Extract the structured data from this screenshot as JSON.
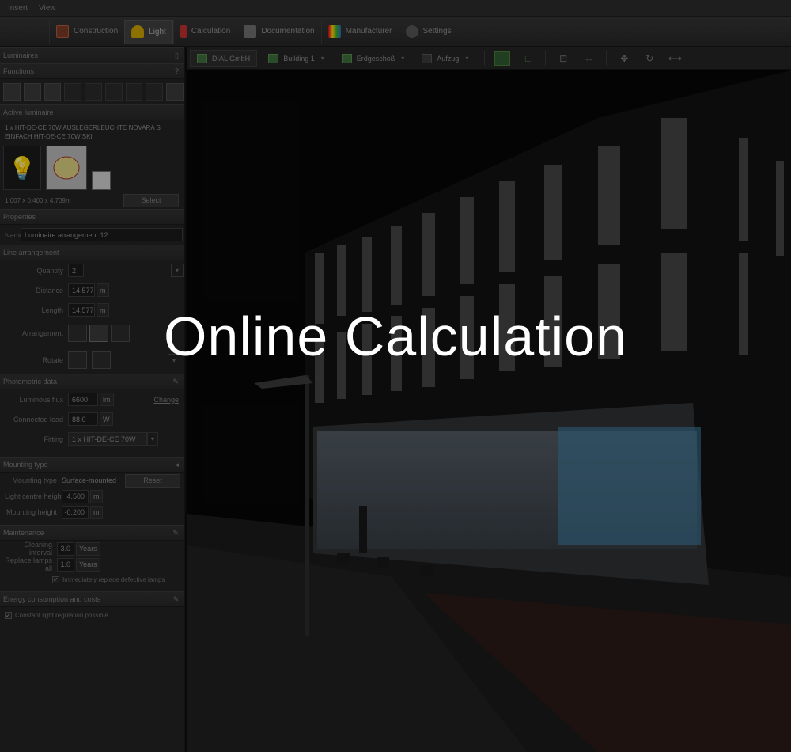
{
  "menu": {
    "insert": "Insert",
    "view": "View"
  },
  "tabs": [
    {
      "label": "Construction"
    },
    {
      "label": "Light"
    },
    {
      "label": "Calculation"
    },
    {
      "label": "Documentation"
    },
    {
      "label": "Manufacturer"
    },
    {
      "label": "Settings"
    }
  ],
  "breadcrumbs": [
    {
      "label": "DIAL GmbH"
    },
    {
      "label": "Building 1"
    },
    {
      "label": "Erdgeschoß"
    },
    {
      "label": "Aufzug"
    }
  ],
  "sidebar": {
    "header": "Luminaires",
    "functions_title": "Functions",
    "active_luminaire_title": "Active luminaire",
    "luminaire_name_line1": "1 x HIT-DE-CE 70W AUSLEGERLEUCHTE NOVARA S",
    "luminaire_name_line2": "EINFACH HIT-DE-CE 70W SKI",
    "dimensions": "1.007 x 0.400 x 4.709m",
    "select_button": "Select",
    "properties_title": "Properties",
    "name_label": "Name",
    "name_value": "Luminaire arrangement 12",
    "line_arrangement_title": "Line arrangement",
    "quantity_label": "Quantity",
    "quantity_value": "2",
    "distance_label": "Distance",
    "distance_value": "14.577",
    "distance_unit": "m",
    "length_label": "Length",
    "length_value": "14.577",
    "length_unit": "m",
    "arrangement_label": "Arrangement",
    "rotate_label": "Rotate",
    "photometric_title": "Photometric data",
    "flux_label": "Luminous flux",
    "flux_value": "6600",
    "flux_unit": "lm",
    "change_link": "Change",
    "load_label": "Connected load",
    "load_value": "88.0",
    "load_unit": "W",
    "fitting_label": "Fitting",
    "fitting_value": "1 x HIT-DE-CE 70W",
    "mounting_title": "Mounting type",
    "mounting_type_label": "Mounting type",
    "mounting_type_value": "Surface-mounted",
    "reset_button": "Reset",
    "light_centre_label": "Light centre height",
    "light_centre_value": "4.500",
    "light_centre_unit": "m",
    "mounting_height_label": "Mounting height",
    "mounting_height_value": "-0.200",
    "mounting_height_unit": "m",
    "maintenance_title": "Maintenance",
    "cleaning_label": "Cleaning interval",
    "cleaning_value": "3.0",
    "cleaning_unit": "Years",
    "replace_label": "Replace lamps all",
    "replace_value": "1.0",
    "replace_unit": "Years",
    "replace_check_label": "Immediately replace defective lamps",
    "energy_title": "Energy consumption and costs",
    "regulation_label": "Constant light regulation possible"
  },
  "overlay": {
    "title": "Online Calculation"
  }
}
